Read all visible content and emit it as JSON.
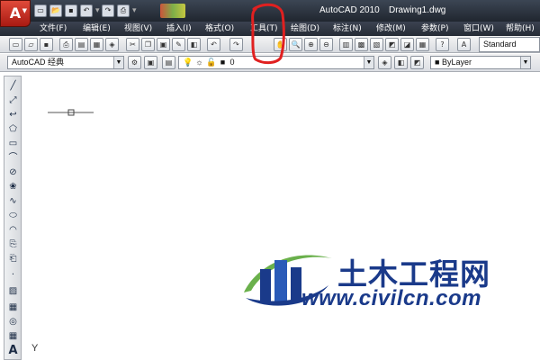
{
  "app": {
    "title": "AutoCAD 2010",
    "document": "Drawing1.dwg",
    "app_button_letter": "A"
  },
  "quick_access": [
    "new-icon",
    "open-icon",
    "save-icon",
    "undo-icon",
    "redo-icon",
    "plot-icon"
  ],
  "menus": [
    {
      "label": "文件(F)"
    },
    {
      "label": "编辑(E)"
    },
    {
      "label": "视图(V)"
    },
    {
      "label": "插入(I)"
    },
    {
      "label": "格式(O)"
    },
    {
      "label": "工具(T)"
    },
    {
      "label": "绘图(D)"
    },
    {
      "label": "标注(N)"
    },
    {
      "label": "修改(M)"
    },
    {
      "label": "参数(P)"
    },
    {
      "label": "窗口(W)"
    },
    {
      "label": "帮助(H)"
    }
  ],
  "standard_toolbar": {
    "text_style": "Standard"
  },
  "workspace_toolbar": {
    "workspace": "AutoCAD 经典",
    "layer": "0",
    "color": "ByLayer"
  },
  "draw_tools": [
    "line-icon",
    "construction-line-icon",
    "polyline-icon",
    "polygon-icon",
    "rectangle-icon",
    "arc-icon",
    "circle-icon",
    "revision-cloud-icon",
    "spline-icon",
    "ellipse-icon",
    "ellipse-arc-icon",
    "insert-block-icon",
    "make-block-icon",
    "point-icon",
    "hatch-icon",
    "gradient-icon",
    "region-icon",
    "table-icon",
    "multiline-text-icon"
  ],
  "canvas": {
    "ucs_label": "Y"
  },
  "watermark": {
    "chinese": "土木工程网",
    "url": "www.civilcn.com"
  },
  "colors": {
    "titlebar": "#2b313b",
    "annotation": "#e02020",
    "watermark_blue": "#1a3a8a",
    "watermark_green": "#6ab04c"
  }
}
